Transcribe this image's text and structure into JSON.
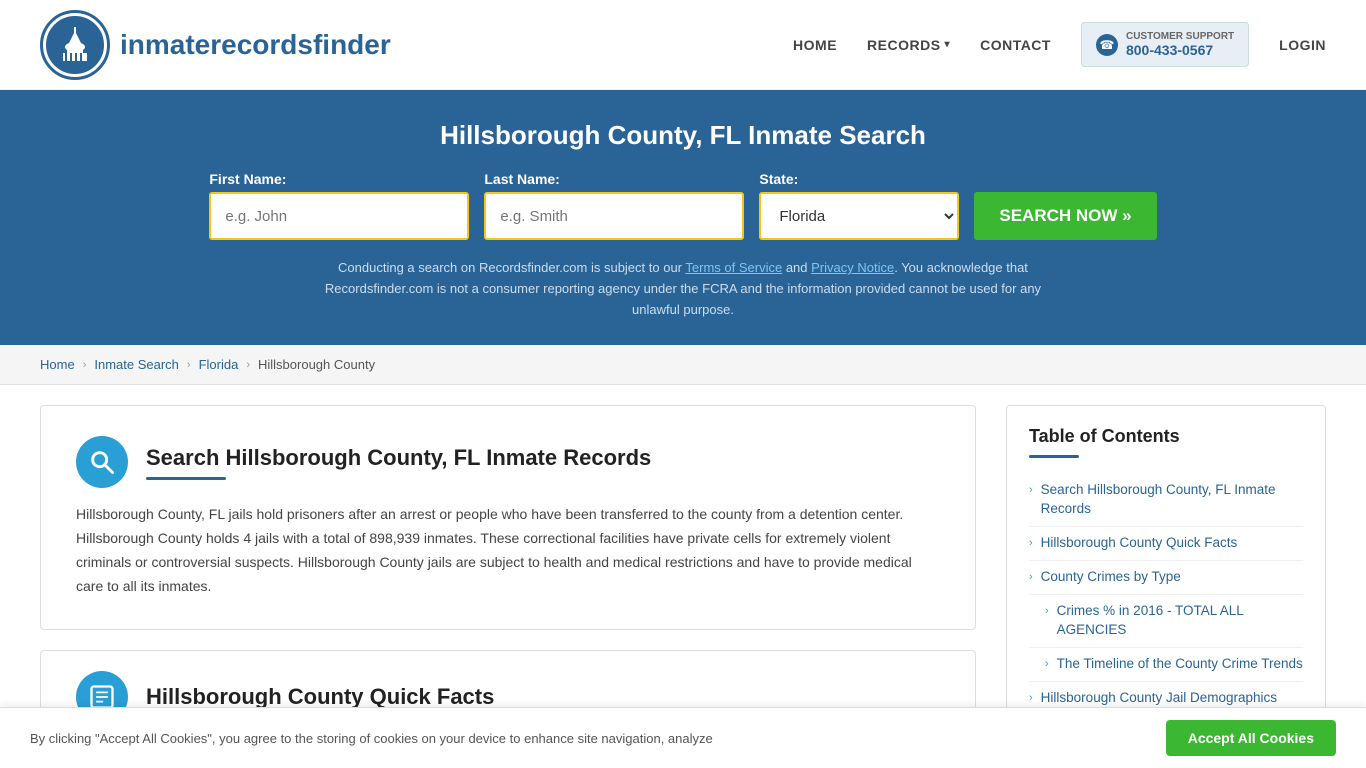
{
  "header": {
    "logo_text_light": "inmaterecords",
    "logo_text_bold": "finder",
    "nav": {
      "home": "HOME",
      "records": "RECORDS",
      "contact": "CONTACT",
      "login": "LOGIN"
    },
    "support": {
      "label": "CUSTOMER SUPPORT",
      "phone": "800-433-0567"
    }
  },
  "hero": {
    "title": "Hillsborough County, FL Inmate Search",
    "form": {
      "first_name_label": "First Name:",
      "first_name_placeholder": "e.g. John",
      "last_name_label": "Last Name:",
      "last_name_placeholder": "e.g. Smith",
      "state_label": "State:",
      "state_value": "Florida",
      "search_button": "SEARCH NOW »"
    },
    "disclaimer": "Conducting a search on Recordsfinder.com is subject to our Terms of Service and Privacy Notice. You acknowledge that Recordsfinder.com is not a consumer reporting agency under the FCRA and the information provided cannot be used for any unlawful purpose."
  },
  "breadcrumb": {
    "home": "Home",
    "inmate_search": "Inmate Search",
    "florida": "Florida",
    "current": "Hillsborough County"
  },
  "main_card": {
    "title": "Search Hillsborough County, FL Inmate Records",
    "body": "Hillsborough County, FL jails hold prisoners after an arrest or people who have been transferred to the county from a detention center. Hillsborough County holds 4 jails with a total of 898,939 inmates. These correctional facilities have private cells for extremely violent criminals or controversial suspects. Hillsborough County jails are subject to health and medical restrictions and have to provide medical care to all its inmates."
  },
  "quick_facts_card": {
    "title": "Hillsborough County Quick Facts"
  },
  "toc": {
    "title": "Table of Contents",
    "items": [
      {
        "label": "Search Hillsborough County, FL Inmate Records",
        "indented": false
      },
      {
        "label": "Hillsborough County Quick Facts",
        "indented": false
      },
      {
        "label": "County Crimes by Type",
        "indented": false
      },
      {
        "label": "Crimes % in 2016 - TOTAL ALL AGENCIES",
        "indented": true
      },
      {
        "label": "The Timeline of the County Crime Trends",
        "indented": true
      },
      {
        "label": "Hillsborough County Jail Demographics",
        "indented": false
      }
    ]
  },
  "cookie_banner": {
    "text": "By clicking \"Accept All Cookies\", you agree to the storing of cookies on your device to enhance site navigation, analyze",
    "button": "Accept All Cookies"
  }
}
